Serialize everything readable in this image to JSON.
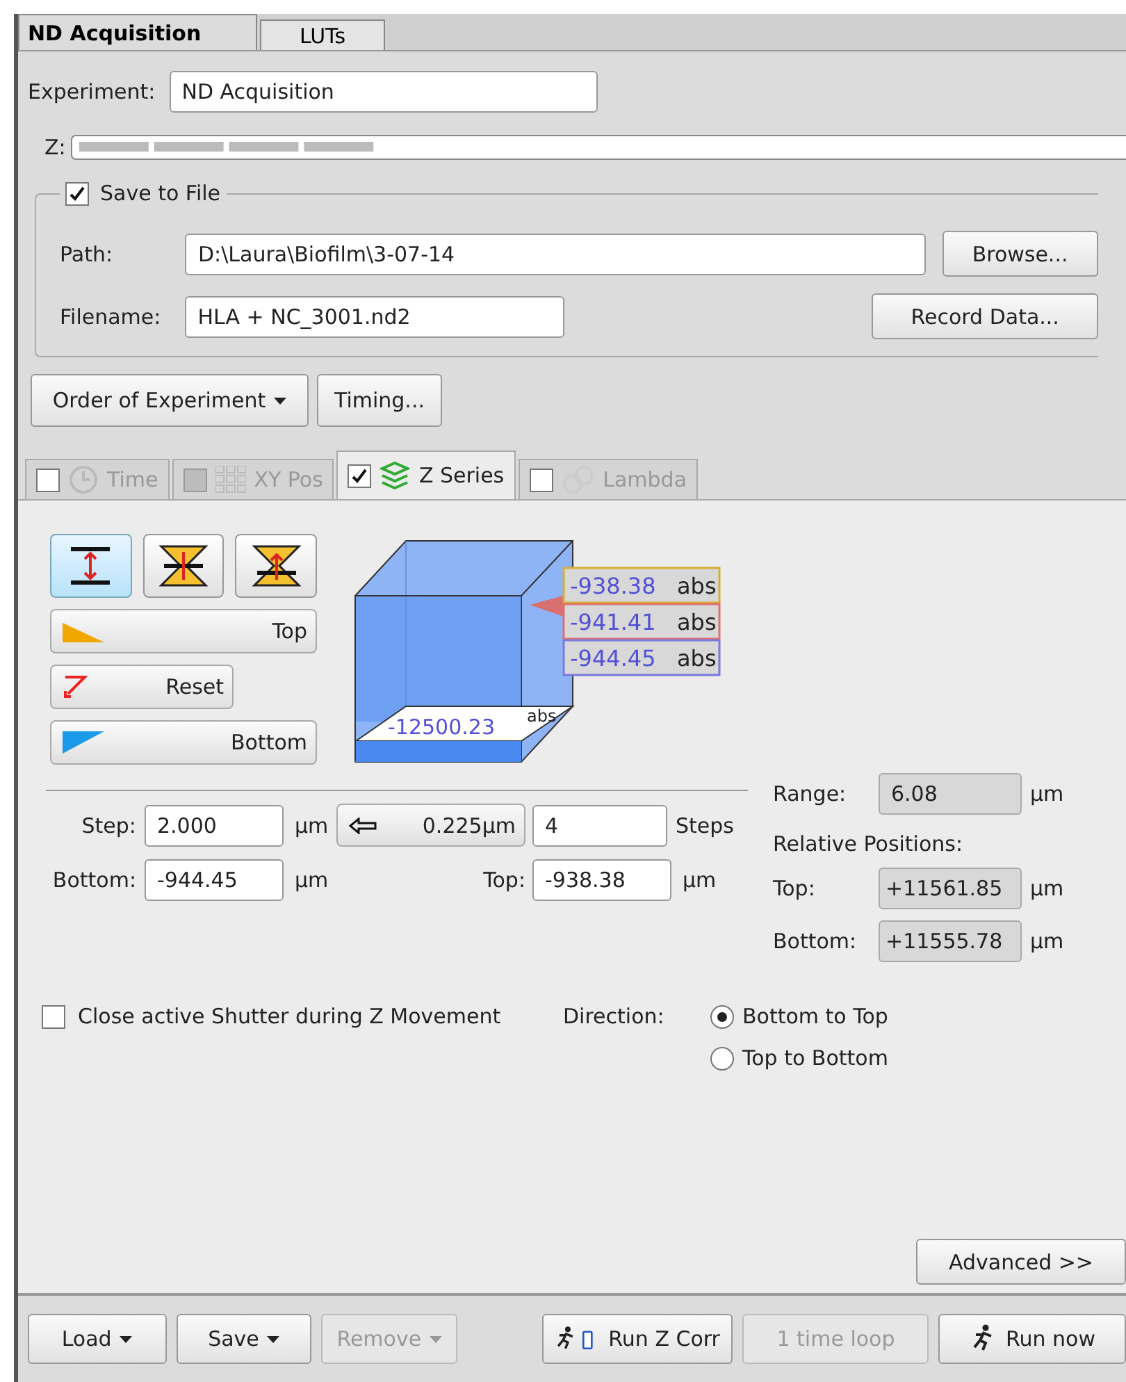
{
  "main_tabs": [
    {
      "label": "ND Acquisition",
      "selected": true
    },
    {
      "label": "LUTs",
      "selected": false
    }
  ],
  "experiment": {
    "label": "Experiment:",
    "value": "ND Acquisition"
  },
  "z_bar": {
    "label": "Z:"
  },
  "save_group": {
    "label": "Save to File",
    "checked": true,
    "path_label": "Path:",
    "path": "D:\\Laura\\Biofilm\\3-07-14",
    "browse": "Browse...",
    "filename_label": "Filename:",
    "filename": "HLA + NC_3001.nd2",
    "record": "Record Data..."
  },
  "order_button": "Order of Experiment",
  "timing_button": "Timing...",
  "sub_tabs": [
    {
      "kind": "time",
      "label": "Time",
      "checked": false,
      "disabled": false,
      "selected": false
    },
    {
      "kind": "xy",
      "label": "XY Pos",
      "checked": false,
      "disabled": true,
      "selected": false
    },
    {
      "kind": "z",
      "label": "Z Series",
      "checked": true,
      "disabled": false,
      "selected": true
    },
    {
      "kind": "lambda",
      "label": "Lambda",
      "checked": false,
      "disabled": false,
      "selected": false
    }
  ],
  "mode_buttons": [
    {
      "kind": "thickness",
      "selected": true
    },
    {
      "kind": "symmetric",
      "selected": false
    },
    {
      "kind": "asymmetric",
      "selected": false
    }
  ],
  "set_buttons": [
    {
      "kind": "top",
      "label": "Top"
    },
    {
      "kind": "reset",
      "label": "Reset"
    },
    {
      "kind": "bottom",
      "label": "Bottom"
    }
  ],
  "cube": {
    "positions": [
      {
        "value": "-938.38",
        "unit": "abs",
        "color": "#d4b030"
      },
      {
        "value": "-941.41",
        "unit": "abs",
        "color": "#e07070"
      },
      {
        "value": "-944.45",
        "unit": "abs",
        "color": "#7878e0"
      }
    ],
    "base_value": "-12500.23",
    "base_unit": "abs"
  },
  "step": {
    "label": "Step:",
    "value": "2.000",
    "unit": "µm",
    "calc_button": "0.225µm",
    "steps_value": "4",
    "steps_label": "Steps"
  },
  "bottom": {
    "label": "Bottom:",
    "value": "-944.45",
    "unit": "µm"
  },
  "top": {
    "label": "Top:",
    "value": "-938.38",
    "unit": "µm"
  },
  "range": {
    "label": "Range:",
    "value": "6.08",
    "unit": "µm"
  },
  "relative": {
    "title": "Relative Positions:",
    "rows": [
      {
        "label": "Top:",
        "value": "+11561.85",
        "unit": "µm"
      },
      {
        "label": "Bottom:",
        "value": "+11555.78",
        "unit": "µm"
      }
    ]
  },
  "shutter": {
    "label": "Close active Shutter during Z Movement",
    "checked": false
  },
  "direction": {
    "label": "Direction:",
    "options": [
      {
        "label": "Bottom to Top",
        "selected": true
      },
      {
        "label": "Top to Bottom",
        "selected": false
      }
    ]
  },
  "advanced_button": "Advanced >>",
  "footer_buttons": [
    {
      "kind": "dropdown",
      "label": "Load",
      "disabled": false
    },
    {
      "kind": "dropdown",
      "label": "Save",
      "disabled": false
    },
    {
      "kind": "dropdown",
      "label": "Remove",
      "disabled": true
    },
    {
      "kind": "zcorr",
      "label": "Run Z Corr",
      "disabled": false
    },
    {
      "kind": "plain",
      "label": "1 time loop",
      "disabled": true
    },
    {
      "kind": "run",
      "label": "Run now",
      "disabled": false
    }
  ]
}
